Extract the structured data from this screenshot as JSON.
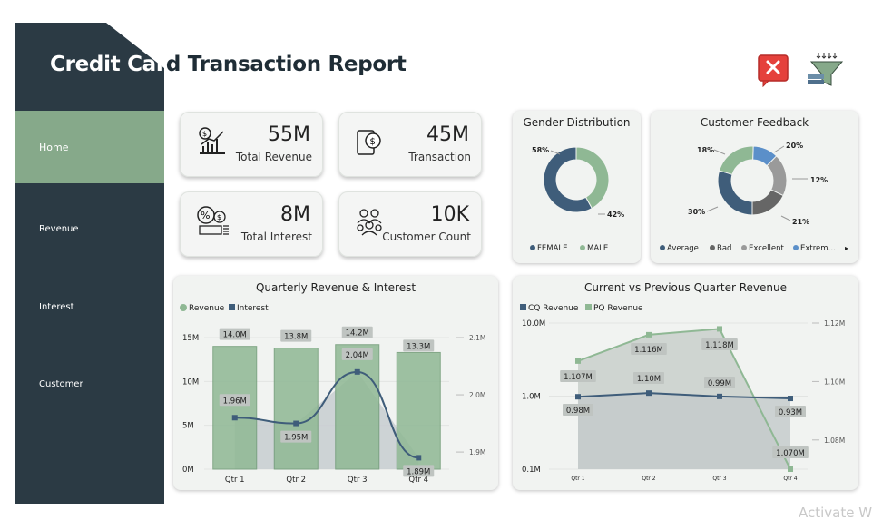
{
  "header": {
    "title_part1": "Credit Car",
    "title_part2": "d Transaction Report"
  },
  "toolbar": {
    "clear_icon": "close-x-icon",
    "filter_icon": "funnel-filter-icon",
    "accent_red": "#e5413c"
  },
  "sidebar": {
    "items": [
      {
        "label": "Home"
      },
      {
        "label": "Revenue"
      },
      {
        "label": "Interest"
      },
      {
        "label": "Customer"
      }
    ],
    "bg_color": "#2b3a44",
    "active_color": "#86a98a"
  },
  "kpis": [
    {
      "value": "55M",
      "label": "Total Revenue",
      "icon": "revenue-chart-icon"
    },
    {
      "value": "45M",
      "label": "Transaction",
      "icon": "card-payment-icon"
    },
    {
      "value": "8M",
      "label": "Total Interest",
      "icon": "interest-percent-icon"
    },
    {
      "value": "10K",
      "label": "Customer Count",
      "icon": "customers-group-icon"
    }
  ],
  "watermark": "Activate W",
  "chart_data": [
    {
      "type": "pie",
      "title": "Gender Distribution",
      "labels": [
        "FEMALE",
        "MALE"
      ],
      "values": [
        58,
        42
      ],
      "value_labels": [
        "58%",
        "42%"
      ],
      "colors": [
        "#3f5d7a",
        "#8fb894"
      ],
      "legend": "bottom"
    },
    {
      "type": "pie",
      "title": "Customer Feedback",
      "labels": [
        "Average",
        "Bad",
        "Excellent",
        "Extrem…"
      ],
      "values": [
        30,
        21,
        12,
        20,
        18
      ],
      "value_labels": [
        "30%",
        "21%",
        "12%",
        "20%",
        "18%"
      ],
      "colors": [
        "#3f5d7a",
        "#8fb894",
        "#5b8fc9",
        "#9a9a9a",
        "#666666"
      ],
      "legend": "bottom",
      "legend_more": "▸"
    },
    {
      "type": "bar",
      "title": "Quarterly Revenue & Interest",
      "categories": [
        "Qtr 1",
        "Qtr 2",
        "Qtr 3",
        "Qtr 4"
      ],
      "series": [
        {
          "name": "Revenue",
          "values": [
            14.0,
            13.8,
            14.2,
            13.3
          ],
          "labels": [
            "14.0M",
            "13.8M",
            "14.2M",
            "13.3M"
          ],
          "color": "#8fb894"
        },
        {
          "name": "Interest",
          "values": [
            1.96,
            1.95,
            2.04,
            1.89
          ],
          "labels": [
            "1.96M",
            "1.95M",
            "2.04M",
            "1.89M"
          ],
          "color": "#3f5d7a"
        }
      ],
      "ylim": [
        0,
        15
      ],
      "y_ticks": [
        "0M",
        "5M",
        "10M",
        "15M"
      ],
      "y2lim": [
        1.87,
        2.1
      ],
      "y2_ticks": [
        "1.9M",
        "2.0M",
        "2.1M"
      ],
      "legend": "top-left"
    },
    {
      "type": "line",
      "title": "Current vs Previous Quarter Revenue",
      "categories": [
        "Qtr 1",
        "Qtr 2",
        "Qtr 3",
        "Qtr 4"
      ],
      "series": [
        {
          "name": "CQ Revenue",
          "values": [
            0.98,
            1.1,
            0.99,
            0.93
          ],
          "labels": [
            "0.98M",
            "1.10M",
            "0.99M",
            "0.93M"
          ],
          "color": "#3f5d7a",
          "axis": "left"
        },
        {
          "name": "PQ Revenue",
          "values": [
            1.107,
            1.116,
            1.118,
            1.07
          ],
          "labels": [
            "1.107M",
            "1.116M",
            "1.118M",
            "1.070M"
          ],
          "color": "#8fb894",
          "axis": "right"
        }
      ],
      "y_ticks": [
        "0.1M",
        "1.0M",
        "10.0M"
      ],
      "y_scale": "log",
      "y2lim": [
        1.07,
        1.12
      ],
      "y2_ticks": [
        "1.08M",
        "1.10M",
        "1.12M"
      ],
      "legend": "top-left"
    }
  ]
}
